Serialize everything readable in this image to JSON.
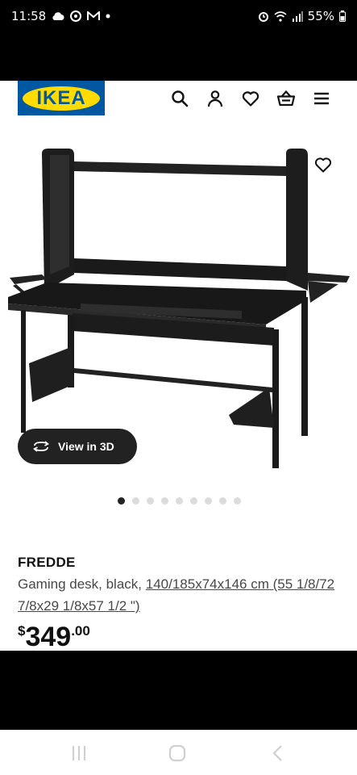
{
  "status_bar": {
    "time": "11:58",
    "battery": "55%",
    "icons": [
      "cloud-icon",
      "bluesky-icon",
      "gmail-icon",
      "dot-icon",
      "alarm-icon",
      "wifi-icon",
      "signal-icon",
      "battery-icon"
    ]
  },
  "header": {
    "logo_text": "IKEA",
    "icons": [
      "search-icon",
      "user-icon",
      "heart-icon",
      "shopping-basket-icon",
      "menu-icon"
    ]
  },
  "gallery": {
    "view_3d_label": "View in 3D",
    "dot_count": 9,
    "active_index": 0
  },
  "product": {
    "name": "FREDDE",
    "description": "Gaming desk, black, ",
    "dimensions": "140/185x74x146 cm (55 1/8/72 7/8x29 1/8x57 1/2 \")",
    "price_symbol": "$",
    "price_integer": "349",
    "price_decimal": ".00"
  },
  "nav_bar": {
    "buttons": [
      "recents-button",
      "home-button",
      "back-button"
    ]
  },
  "colors": {
    "ikea_blue": "#0058a3",
    "ikea_yellow": "#ffdb00",
    "text_dark": "#111111",
    "text_body": "#484848"
  }
}
